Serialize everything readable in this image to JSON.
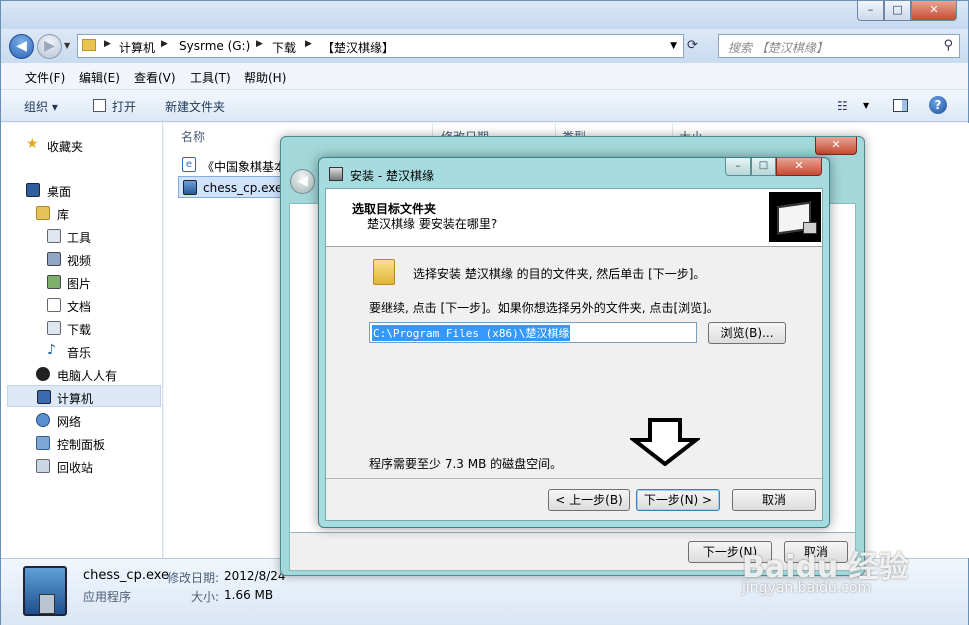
{
  "explorer": {
    "caption_buttons": {
      "minimize": "–",
      "maximize": "□",
      "close": "✕"
    },
    "address": {
      "crumbs": [
        "计算机",
        "Sysrme (G:)",
        "下载",
        "【楚汉棋缘】"
      ],
      "sep": "▶",
      "drop": "▼",
      "refresh": "⟳"
    },
    "search": {
      "placeholder": "搜索 【楚汉棋缘】",
      "icon": "search-icon"
    },
    "menu": [
      "文件(F)",
      "编辑(E)",
      "查看(V)",
      "工具(T)",
      "帮助(H)"
    ],
    "toolbar": {
      "organize": "组织 ▾",
      "open": "打开",
      "new_folder": "新建文件夹",
      "view_icon": "☷",
      "view_drop": "▼",
      "help": "?"
    },
    "sidebar": {
      "favorites": "收藏夹",
      "desktop": "桌面",
      "libraries": "库",
      "tools": "工具",
      "videos": "视频",
      "pictures": "图片",
      "documents": "文档",
      "downloads": "下载",
      "music": "音乐",
      "everyone": "电脑人人有",
      "computer": "计算机",
      "network": "网络",
      "control_panel": "控制面板",
      "recycle_bin": "回收站"
    },
    "columns": {
      "name": "名称",
      "modified": "修改日期",
      "type": "类型",
      "size": "大小"
    },
    "files": [
      {
        "name": "《中国象棋基本"
      },
      {
        "name": "chess_cp.exe"
      }
    ],
    "details": {
      "filename": "chess_cp.exe",
      "modified_label": "修改日期:",
      "modified_value": "2012/8/24",
      "type": "应用程序",
      "size_label": "大小:",
      "size_value": "1.66 MB"
    }
  },
  "outer_dialog": {
    "close": "✕",
    "back": "◀",
    "next_label": "下一步(N)",
    "cancel_label": "取消"
  },
  "wizard": {
    "title": "安装 - 楚汉棋缘",
    "caption_buttons": {
      "minimize": "–",
      "maximize": "□",
      "close": "✕"
    },
    "header_title": "选取目标文件夹",
    "header_subtitle": "楚汉棋缘 要安装在哪里?",
    "line1": "选择安装 楚汉棋缘 的目的文件夹, 然后单击 [下一步]。",
    "line2": "要继续, 点击 [下一步]。如果你想选择另外的文件夹, 点击[浏览]。",
    "path_value": "C:\\Program Files (x86)\\楚汉棋缘",
    "browse_label": "浏览(B)...",
    "space_text": "程序需要至少 7.3 MB 的磁盘空间。",
    "prev_label": "< 上一步(B)",
    "next_label": "下一步(N) >",
    "cancel_label": "取消"
  },
  "watermark": {
    "main": "Baidu 经验",
    "sub": "jingyan.baidu.com"
  },
  "colors": {
    "wizard_frame": "#a6dcdf",
    "selection_blue": "#3399ff",
    "close_red": "#c74a33"
  }
}
